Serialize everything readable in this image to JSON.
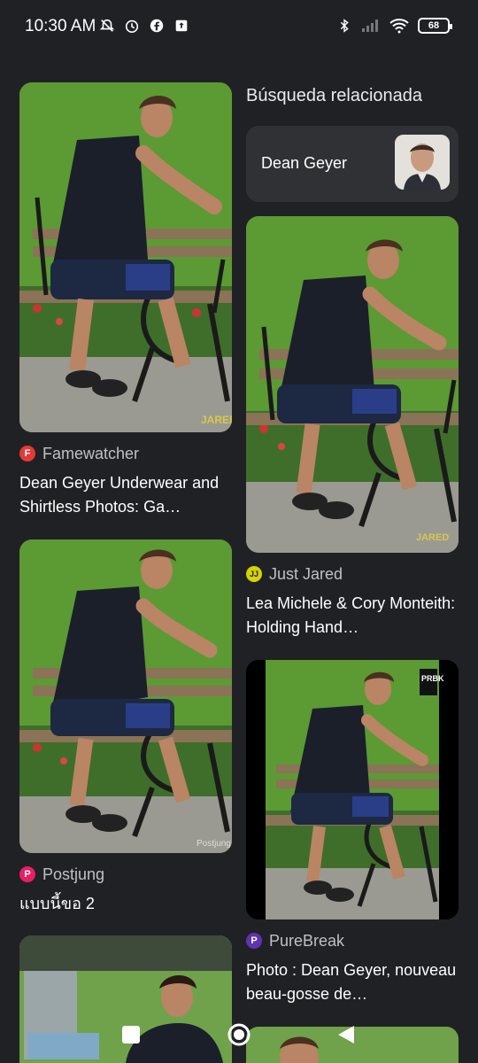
{
  "status": {
    "time": "10:30 AM",
    "battery": "68",
    "left_icons": [
      "mute-bell-icon",
      "alarm-icon",
      "facebook-icon",
      "upload-icon"
    ],
    "right_icons": [
      "bluetooth-icon",
      "signal-icon",
      "wifi-icon",
      "battery-icon"
    ]
  },
  "related": {
    "heading": "Búsqueda relacionada",
    "query": "Dean Geyer"
  },
  "results_left": [
    {
      "source": "Famewatcher",
      "favicon_letter": "F",
      "favicon_color": "#e53935",
      "title": "Dean Geyer Underwear and Shirtless Photos: Ga…",
      "watermark": "JARED"
    },
    {
      "source": "Postjung",
      "favicon_letter": "P",
      "favicon_color": "#e91e63",
      "title": "แบบนี้ขอ 2",
      "watermark": "Postjung"
    },
    {
      "source": "",
      "favicon_letter": "",
      "favicon_color": "",
      "title": "",
      "watermark": ""
    }
  ],
  "results_right": [
    {
      "source": "Just Jared",
      "favicon_letter": "JJ",
      "favicon_color": "#d4d400",
      "title": "Lea Michele & Cory Monteith: Holding Hand…",
      "watermark": "JARED"
    },
    {
      "source": "PureBreak",
      "favicon_letter": "P",
      "favicon_color": "#5e35b1",
      "title": "Photo : Dean Geyer, nouveau beau-gosse de…",
      "watermark": "PRBK"
    },
    {
      "source": "",
      "favicon_letter": "",
      "favicon_color": "",
      "title": "",
      "watermark": ""
    }
  ],
  "nav": {
    "buttons": [
      "recents-button",
      "home-button",
      "back-button"
    ]
  }
}
